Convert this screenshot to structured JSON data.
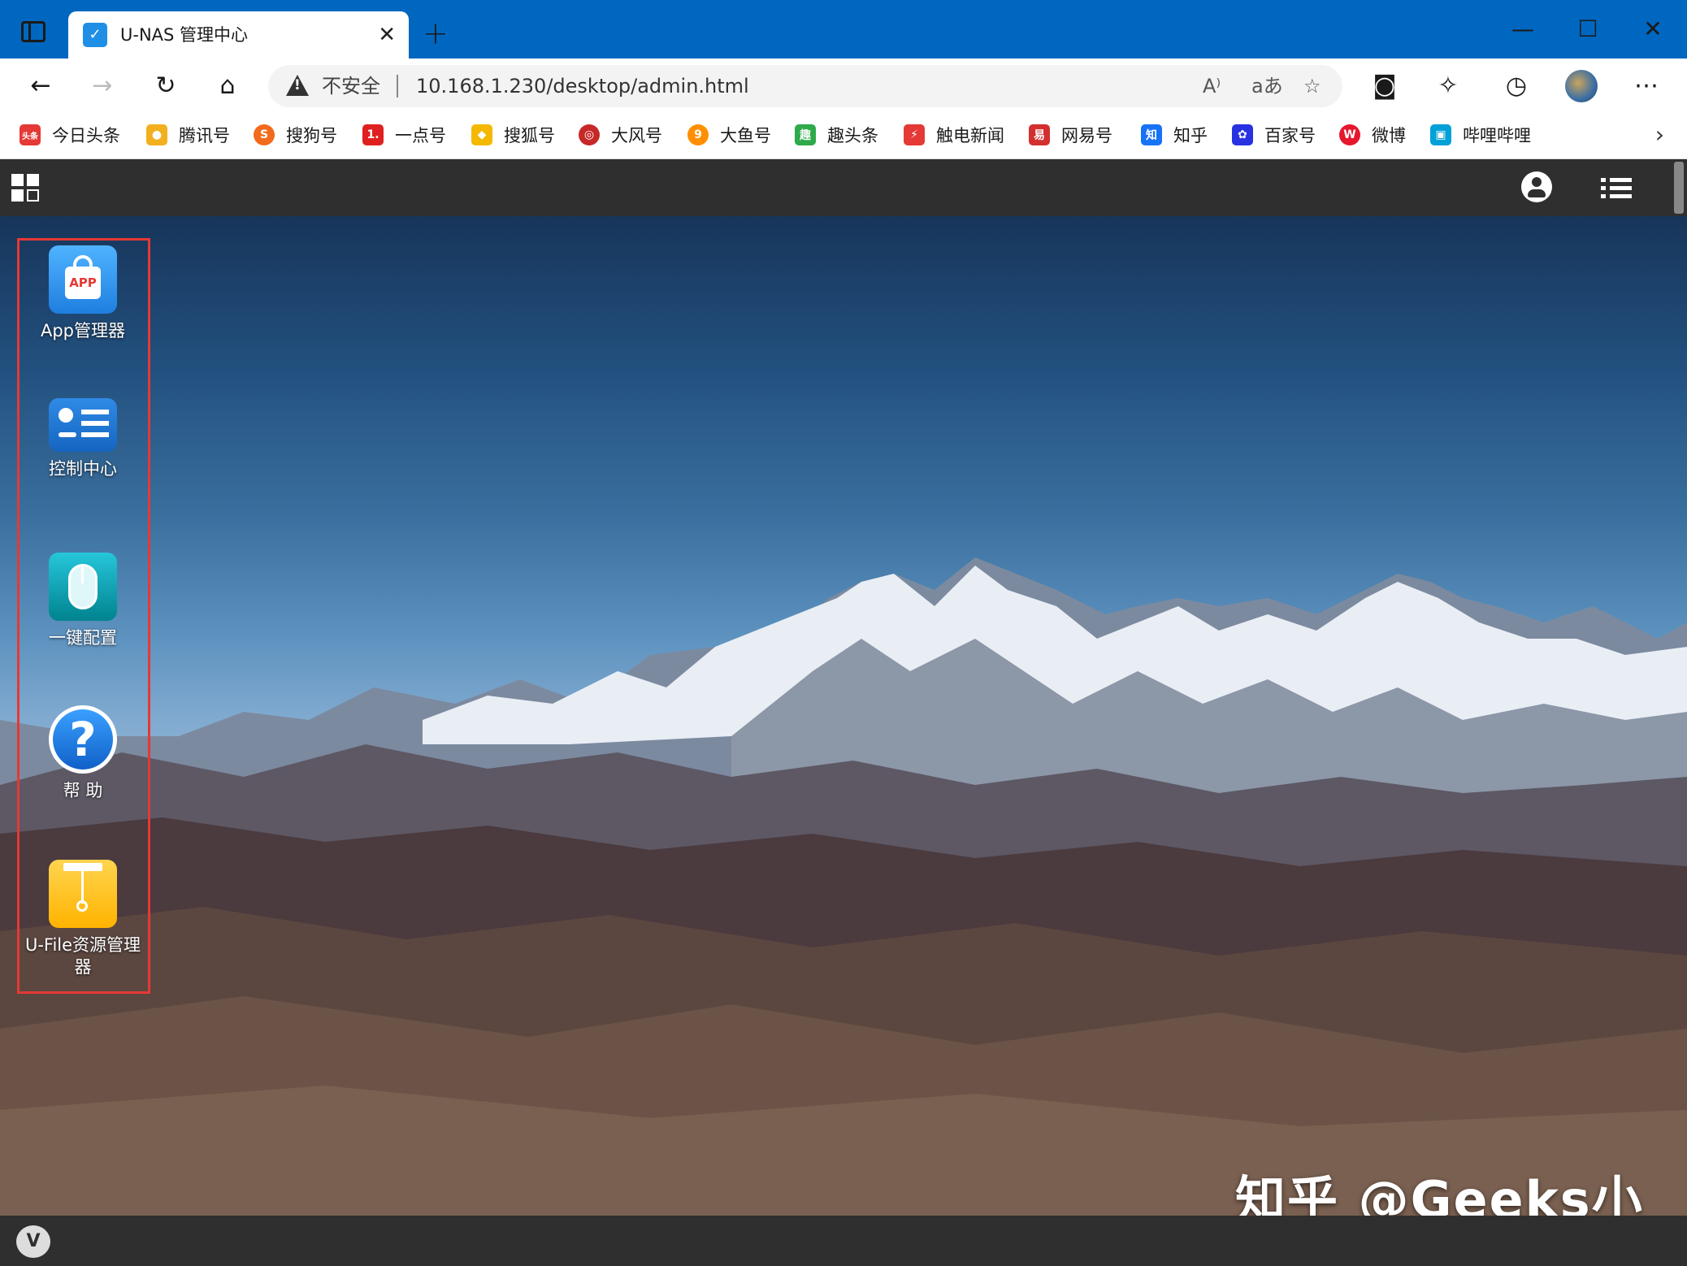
{
  "browser": {
    "tab_title": "U-NAS 管理中心",
    "tab_close": "✕",
    "new_tab": "+",
    "favicon": "✓",
    "window_controls": [
      "—",
      "☐",
      "✕"
    ],
    "security_label": "不安全",
    "url": "10.168.1.230/desktop/admin.html"
  },
  "bookmarks": [
    {
      "label": "今日头条",
      "icon": "toutiao-icon",
      "color": "#e53935",
      "glyph": "头条"
    },
    {
      "label": "腾讯号",
      "icon": "tencent-icon",
      "color": "#f2b01e",
      "glyph": "●"
    },
    {
      "label": "搜狗号",
      "icon": "sogou-icon",
      "color": "#f26b1d",
      "glyph": "S"
    },
    {
      "label": "一点号",
      "icon": "yidian-icon",
      "color": "#e02020",
      "glyph": "1."
    },
    {
      "label": "搜狐号",
      "icon": "sohu-icon",
      "color": "#f5b800",
      "glyph": "◆"
    },
    {
      "label": "大风号",
      "icon": "dafeng-icon",
      "color": "#c62828",
      "glyph": "◎"
    },
    {
      "label": "大鱼号",
      "icon": "dayu-icon",
      "color": "#ff8f00",
      "glyph": "9"
    },
    {
      "label": "趣头条",
      "icon": "qutoutiao-icon",
      "color": "#2eaa4b",
      "glyph": "趣"
    },
    {
      "label": "触电新闻",
      "icon": "chudian-icon",
      "color": "#e53935",
      "glyph": "⚡"
    },
    {
      "label": "网易号",
      "icon": "netease-icon",
      "color": "#d32f2f",
      "glyph": "易"
    },
    {
      "label": "知乎",
      "icon": "zhihu-icon",
      "color": "#1772f6",
      "glyph": "知"
    },
    {
      "label": "百家号",
      "icon": "baijia-icon",
      "color": "#2932e1",
      "glyph": "✿"
    },
    {
      "label": "微博",
      "icon": "weibo-icon",
      "color": "#e6162d",
      "glyph": "W"
    },
    {
      "label": "哔哩哔哩",
      "icon": "bilibili-icon",
      "color": "#00a1d6",
      "glyph": "▣"
    }
  ],
  "apps": [
    {
      "label": "App管理器"
    },
    {
      "label": "控制中心"
    },
    {
      "label": "一键配置"
    },
    {
      "label": "帮 助"
    },
    {
      "label": "U-File资源管理器"
    }
  ],
  "watermark": "知乎 @Geeks小树",
  "taskbar": {
    "logo": "V"
  }
}
